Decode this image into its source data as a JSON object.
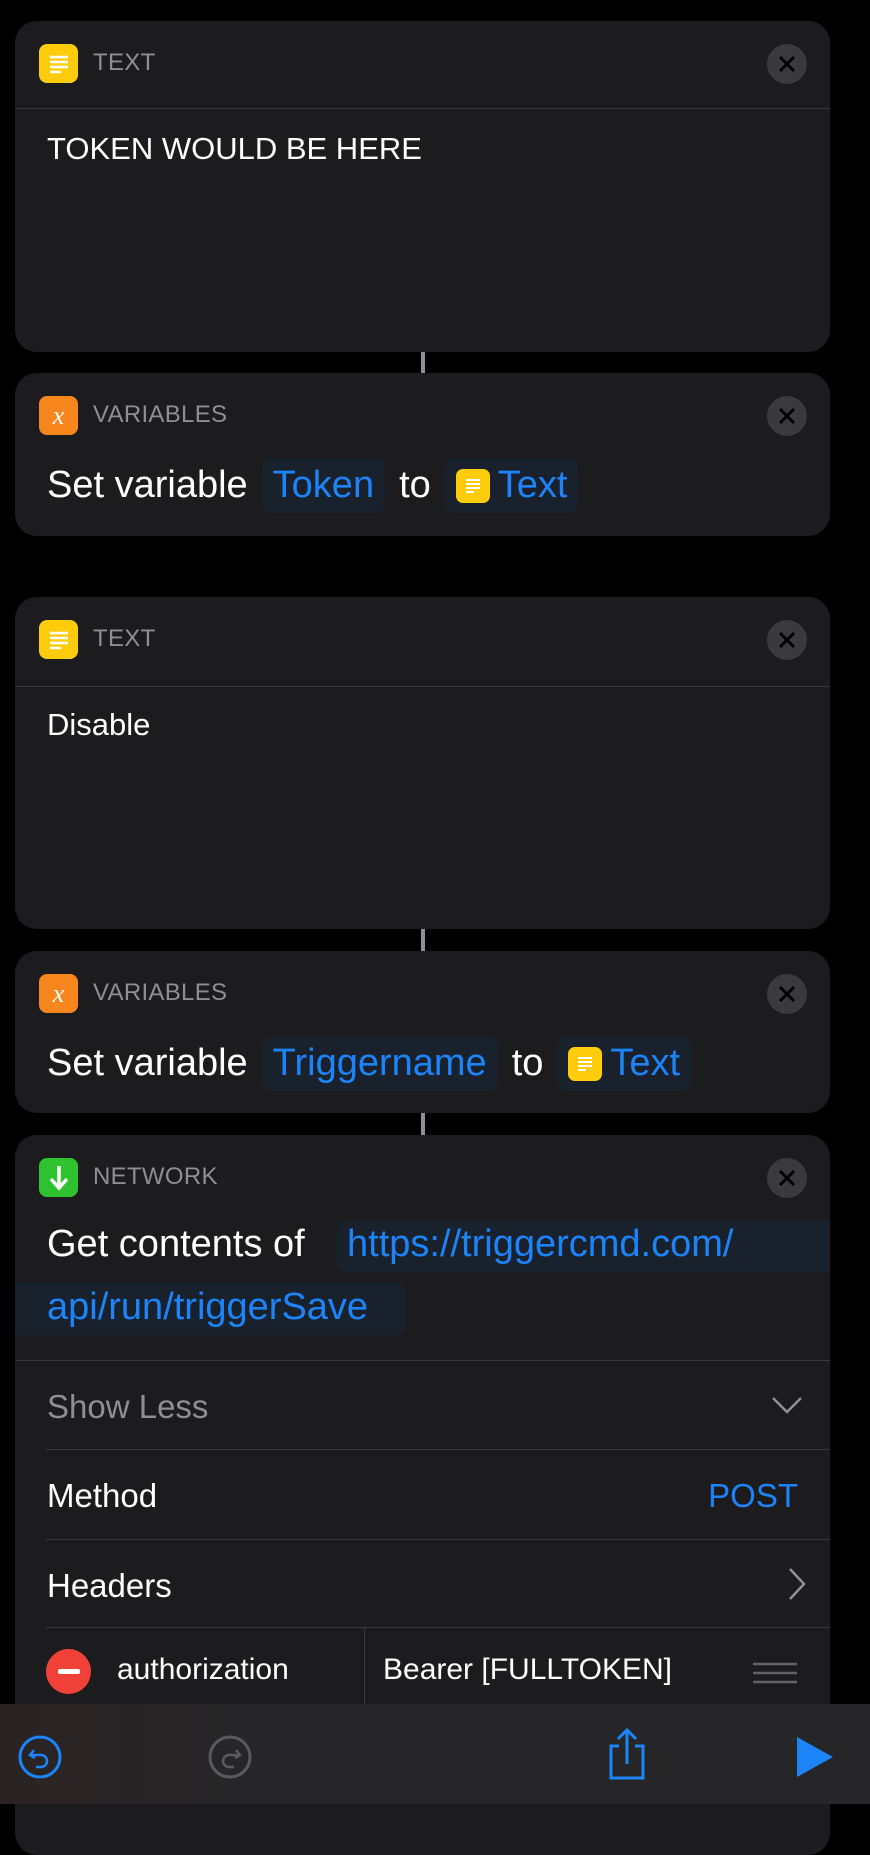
{
  "colors": {
    "accent": "#1c84f8",
    "text_icon": "#fecc0a",
    "variables_icon": "#f7861c",
    "network_icon": "#2ec22e",
    "delete": "#f04038",
    "card": "#1c1c1e"
  },
  "actions": [
    {
      "category": "TEXT",
      "icon": "text-lines-icon",
      "content": "TOKEN WOULD BE HERE"
    },
    {
      "category": "VARIABLES",
      "icon": "variable-x-icon",
      "prefix": "Set variable",
      "variable": "Token",
      "to": "to",
      "value": "Text"
    },
    {
      "category": "TEXT",
      "icon": "text-lines-icon",
      "content": "Disable"
    },
    {
      "category": "VARIABLES",
      "icon": "variable-x-icon",
      "prefix": "Set variable",
      "variable": "Triggername",
      "to": "to",
      "value": "Text"
    },
    {
      "category": "NETWORK",
      "icon": "download-arrow-icon",
      "prefix": "Get contents of",
      "url_line1": "https://triggercmd.com/",
      "url_line2": "api/run/triggerSave",
      "show_less": "Show Less",
      "method_label": "Method",
      "method_value": "POST",
      "headers_label": "Headers",
      "header_key": "authorization",
      "header_value": "Bearer [FULLTOKEN]"
    }
  ],
  "toolbar": {
    "undo": "undo-icon",
    "redo": "redo-icon",
    "share": "share-icon",
    "run": "play-icon"
  }
}
